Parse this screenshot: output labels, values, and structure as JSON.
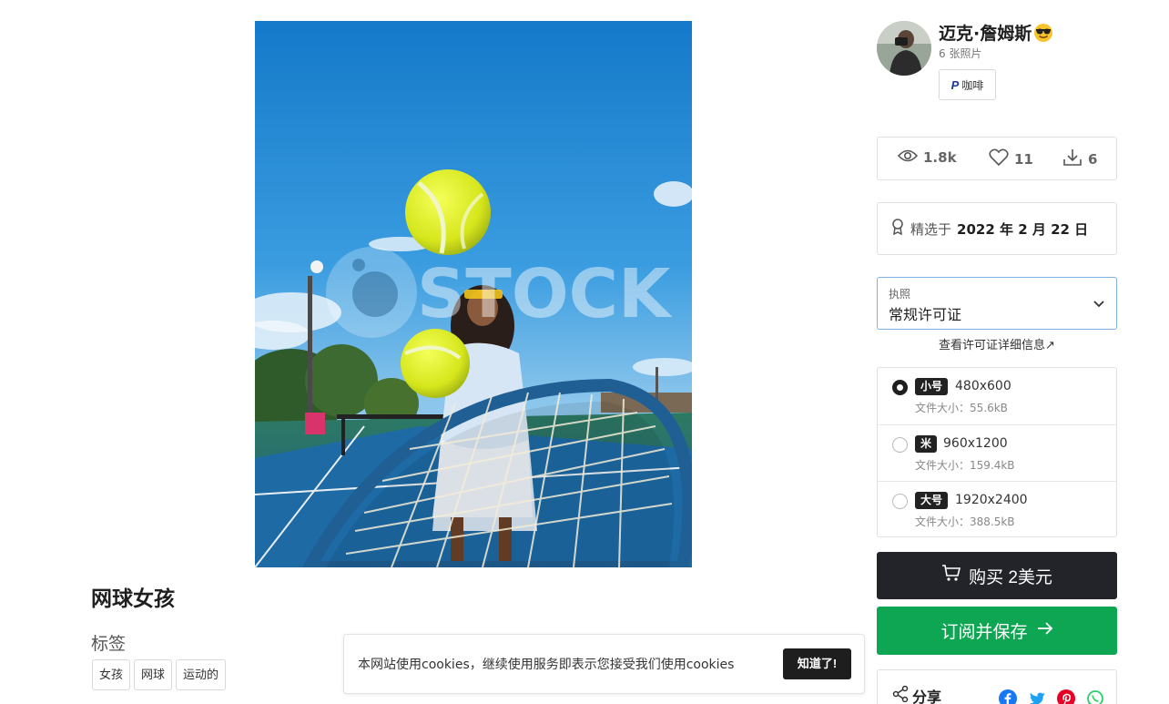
{
  "photo": {
    "alt": "网球女孩",
    "watermark": "STOCK"
  },
  "title": "网球女孩",
  "tags": {
    "heading": "标签",
    "items": [
      "女孩",
      "网球",
      "运动的"
    ]
  },
  "cookie": {
    "text": "本网站使用cookies，继续使用服务即表示您接受我们使用cookies",
    "button": "知道了!"
  },
  "author": {
    "name": "迈克·詹姆斯",
    "emoji": "sunglasses-face",
    "photo_count": "6 张照片",
    "coffee_label": "咖啡",
    "coffee_icon": "paypal-icon"
  },
  "stats": {
    "views": "1.8k",
    "likes": "11",
    "downloads": "6"
  },
  "featured": {
    "prefix": "精选于",
    "date": "2022 年 2 月 22 日"
  },
  "license": {
    "label": "执照",
    "value": "常规许可证",
    "details_link": "查看许可证详细信息↗"
  },
  "sizes": [
    {
      "badge": "小号",
      "dims": "480x600",
      "file": "文件大小：55.6kB",
      "selected": true
    },
    {
      "badge": "米",
      "dims": "960x1200",
      "file": "文件大小：159.4kB",
      "selected": false
    },
    {
      "badge": "大号",
      "dims": "1920x2400",
      "file": "文件大小：388.5kB",
      "selected": false
    }
  ],
  "buy": {
    "label": "购买 2美元"
  },
  "subscribe": {
    "label": "订阅并保存"
  },
  "share": {
    "label": "分享",
    "networks": [
      "facebook-icon",
      "twitter-icon",
      "pinterest-icon",
      "whatsapp-icon"
    ]
  },
  "colors": {
    "buy_bg": "#222429",
    "subscribe_bg": "#0ea653",
    "license_border": "#7eb1e6",
    "facebook": "#1877f2",
    "twitter": "#1da1f2",
    "pinterest": "#e60023",
    "whatsapp": "#25d366"
  }
}
